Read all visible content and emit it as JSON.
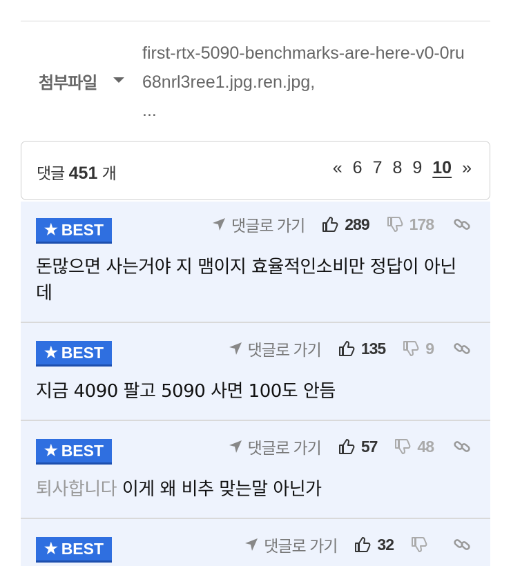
{
  "attachment": {
    "label": "첨부파일",
    "file_name": "first-rtx-5090-benchmarks-are-here-v0-0ru68nrl3ree1.jpg.ren.jpg,",
    "more": "..."
  },
  "comments_header": {
    "prefix": "댓글",
    "count": "451",
    "suffix": "개",
    "pager": {
      "prev": "«",
      "pages": [
        "6",
        "7",
        "8",
        "9",
        "10"
      ],
      "current": "10",
      "next": "»"
    }
  },
  "best_label": "BEST",
  "reply_label": "댓글로 가기",
  "comments": [
    {
      "up": "289",
      "down": "178",
      "text": "돈많으면 사는거야 지 맴이지 효율적인소비만 정답이 아닌데"
    },
    {
      "up": "135",
      "down": "9",
      "text": "지금 4090 팔고 5090 사면 100도 안듬"
    },
    {
      "up": "57",
      "down": "48",
      "prefix": "퇴사합니다",
      "text": "이게 왜 비추 맞는말 아닌가"
    },
    {
      "up": "32",
      "down": ""
    }
  ]
}
